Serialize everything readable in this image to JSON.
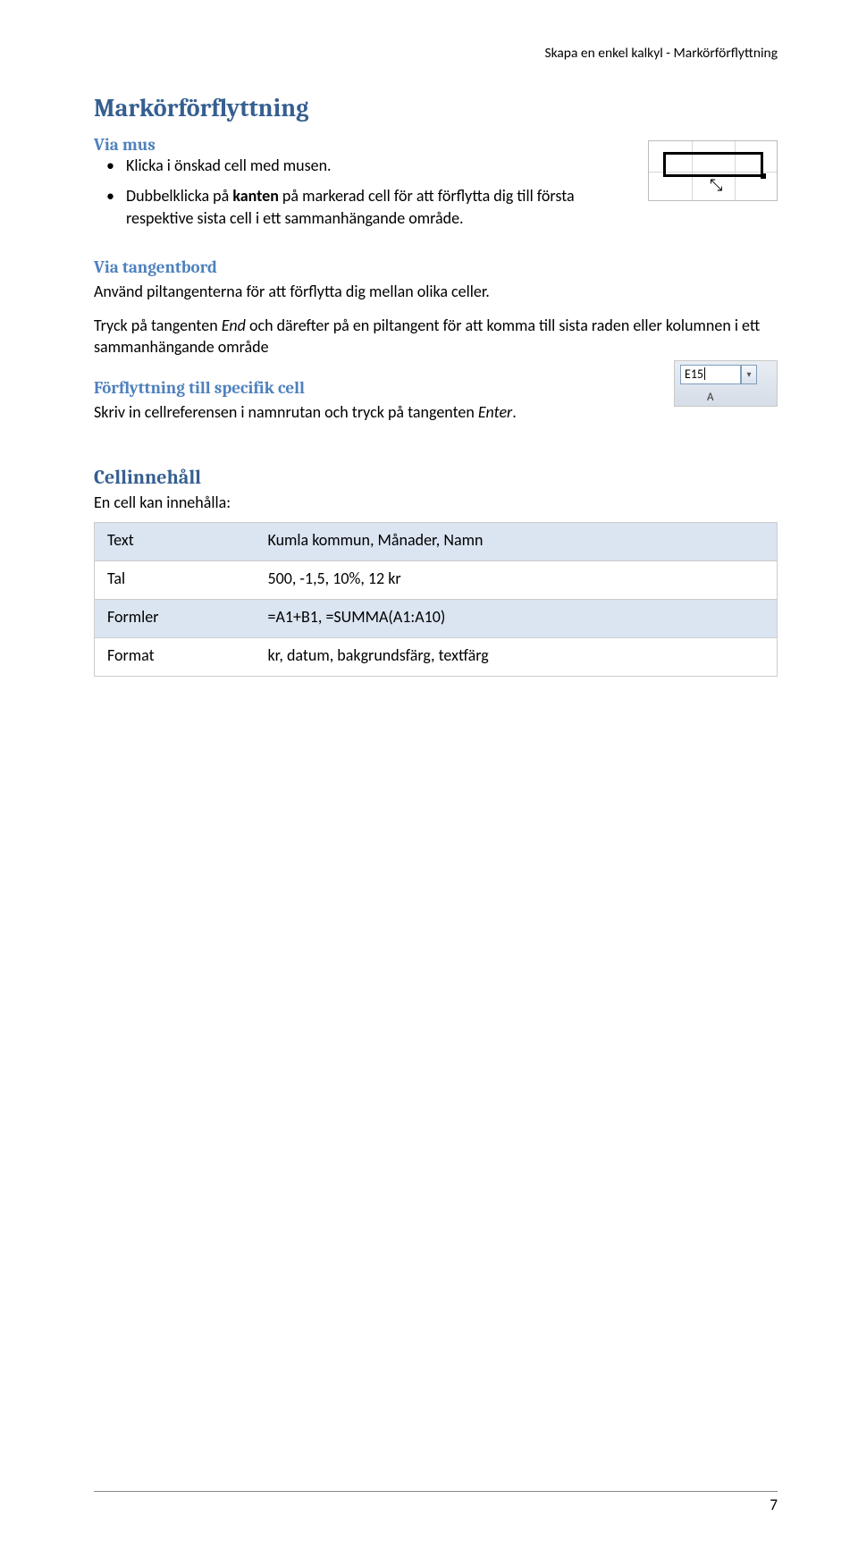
{
  "header": "Skapa en enkel kalkyl - Markörförflyttning",
  "title": "Markörförflyttning",
  "sections": {
    "via_mus": {
      "heading": "Via mus",
      "bullet1": "Klicka i önskad cell med musen.",
      "bullet2a": "Dubbelklicka på ",
      "bullet2b_bold": "kanten",
      "bullet2c": " på markerad cell för att förflytta dig till första respektive sista cell i ett sammanhängande område."
    },
    "via_tangentbord": {
      "heading": "Via tangentbord",
      "p1": "Använd piltangenterna för att förflytta dig mellan olika celler.",
      "p2a": "Tryck på tangenten ",
      "p2b_italic": "End",
      "p2c": " och därefter på en piltangent för att komma till sista raden eller kolumnen i ett sammanhängande område"
    },
    "specifik_cell": {
      "heading": "Förflyttning till specifik cell",
      "p1a": "Skriv in cellreferensen i namnrutan och tryck på tangenten ",
      "p1b_italic": "Enter",
      "p1c": "."
    },
    "cellinnehall": {
      "heading": "Cellinnehåll",
      "intro": "En cell kan innehålla:"
    }
  },
  "fig2": {
    "namebox_value": "E15",
    "dropdown_glyph": "▾",
    "col_label": "A"
  },
  "table": {
    "rows": [
      {
        "k": "Text",
        "v": "Kumla kommun, Månader, Namn"
      },
      {
        "k": "Tal",
        "v": "500, -1,5, 10%, 12 kr"
      },
      {
        "k": "Formler",
        "v": "=A1+B1, =SUMMA(A1:A10)"
      },
      {
        "k": "Format",
        "v": "kr, datum, bakgrundsfärg, textfärg"
      }
    ]
  },
  "page_number": "7"
}
